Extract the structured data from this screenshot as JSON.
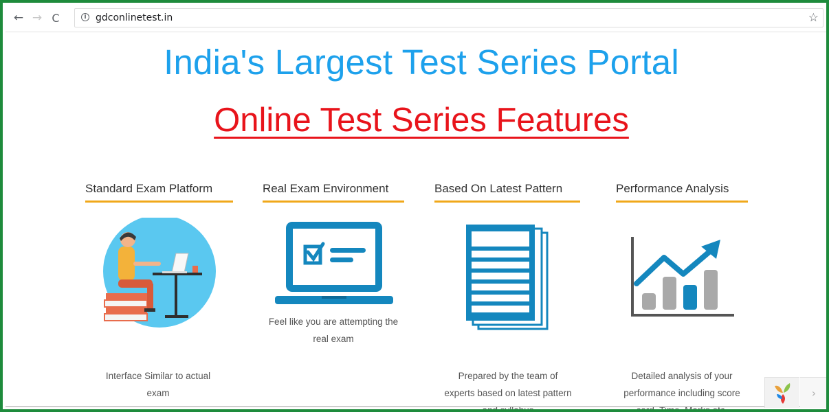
{
  "browser": {
    "back_icon": "←",
    "forward_icon": "→",
    "reload_icon": "C",
    "info_icon": "i",
    "url": "gdconlinetest.in",
    "star_icon": "☆"
  },
  "page": {
    "hero_title": "India's Largest Test Series Portal",
    "features_title": "Online Test Series Features",
    "features": [
      {
        "heading": "Standard Exam Platform",
        "desc_lines": [
          "Interface Similar to actual",
          "exam"
        ],
        "icon": "student-at-desk-icon"
      },
      {
        "heading": "Real Exam Environment",
        "desc_lines": [
          "Feel like you are attempting the",
          "real exam"
        ],
        "icon": "laptop-checklist-icon"
      },
      {
        "heading": "Based On Latest Pattern",
        "desc_lines": [
          "Prepared by the team of",
          "experts based on latest pattern",
          "and syllabus"
        ],
        "icon": "document-stack-icon"
      },
      {
        "heading": "Performance Analysis",
        "desc_lines": [
          "Detailed analysis of your",
          "performance including score",
          "card, Time, Marks etc."
        ],
        "icon": "growth-chart-icon"
      }
    ]
  },
  "widget": {
    "logo_icon": "brand-logo-icon",
    "next_icon": "›"
  },
  "colors": {
    "frame_border": "#1e8b3c",
    "hero_blue": "#1da1ec",
    "features_red": "#e8141b",
    "underline_orange": "#f0a81a",
    "icon_teal": "#1487be"
  }
}
